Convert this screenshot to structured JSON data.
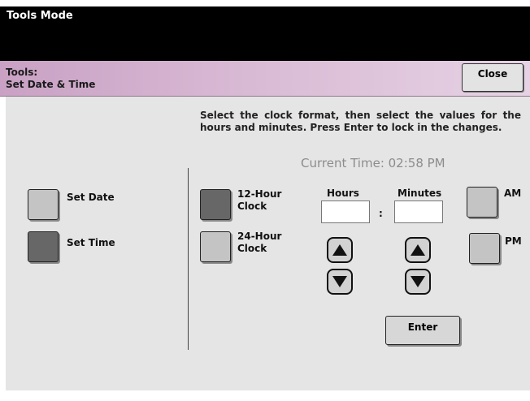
{
  "window": {
    "title": "Tools Mode"
  },
  "header": {
    "line1": "Tools:",
    "line2": "Set Date & Time",
    "close_label": "Close"
  },
  "instructions": "Select the clock format, then select the values for the hours and minutes.  Press Enter to lock in the changes.",
  "current_time": "Current Time:  02:58 PM",
  "left_menu": {
    "set_date": "Set Date",
    "set_time": "Set Time",
    "selected": "Set Time"
  },
  "clock_format": {
    "h12_line1": "12-Hour",
    "h12_line2": "Clock",
    "h24_line1": "24-Hour",
    "h24_line2": "Clock",
    "selected": "12-Hour"
  },
  "time_inputs": {
    "hours_label": "Hours",
    "minutes_label": "Minutes",
    "separator": ":",
    "hours_value": "",
    "minutes_value": ""
  },
  "period": {
    "am": "AM",
    "pm": "PM"
  },
  "enter_label": "Enter",
  "colors": {
    "header_gradient_start": "#c9a1c4",
    "header_gradient_end": "#e6d2e4",
    "selected_button": "#676767",
    "unselected_button": "#c4c4c4",
    "panel": "#e5e5e5",
    "current_time_text": "#8c8c8c"
  }
}
